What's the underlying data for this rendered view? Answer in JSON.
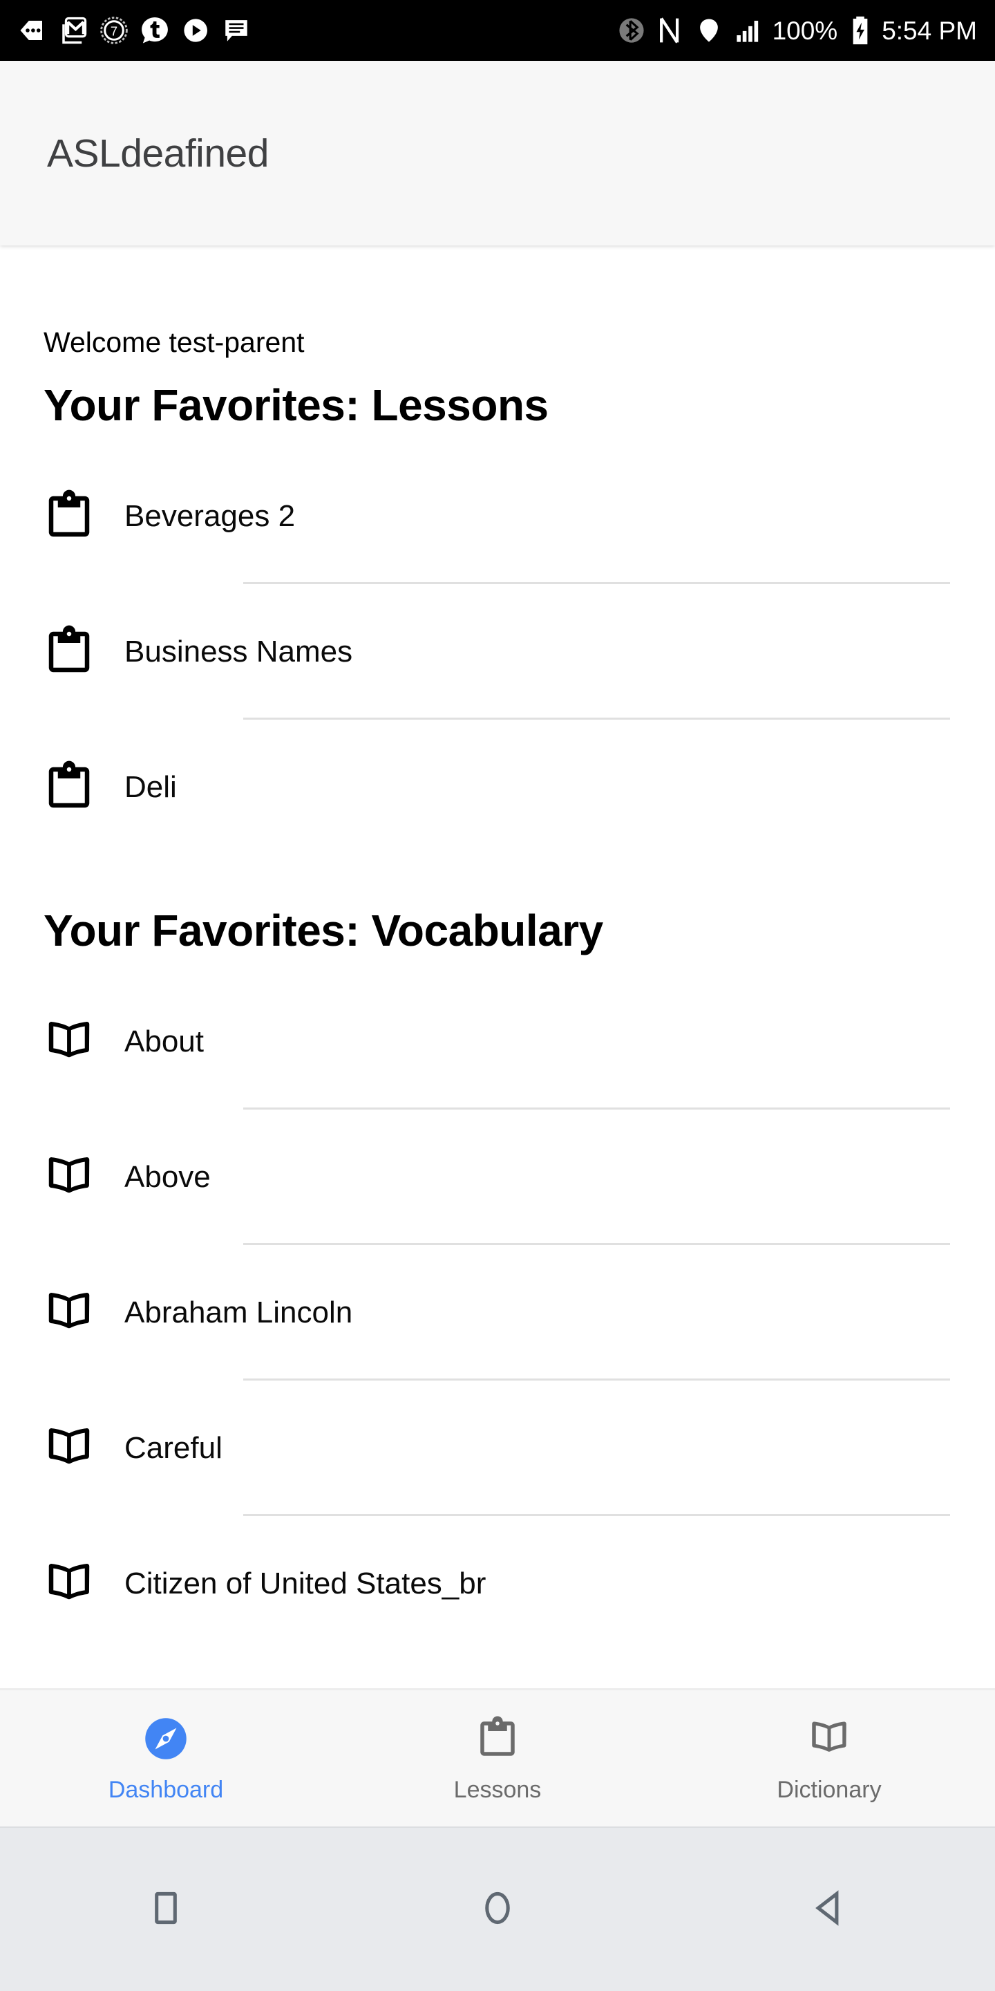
{
  "status_bar": {
    "left_icons": [
      "more-arrow-icon",
      "gmail-icon",
      "seven-circle-icon",
      "tumblr-icon",
      "play-circle-icon",
      "message-icon"
    ],
    "bluetooth_icon": "bluetooth-icon",
    "nfc_icon": "nfc-icon",
    "wifi_icon": "wifi-icon",
    "signal_icon": "cellular-signal-icon",
    "battery_percent": "100%",
    "battery_icon": "battery-charging-icon",
    "time": "5:54 PM"
  },
  "app_bar": {
    "title": "ASLdeafined"
  },
  "main": {
    "welcome": "Welcome test-parent",
    "lessons_section_title": "Your Favorites: Lessons",
    "lessons": [
      {
        "label": "Beverages 2",
        "icon": "clipboard-icon"
      },
      {
        "label": "Business Names",
        "icon": "clipboard-icon"
      },
      {
        "label": "Deli",
        "icon": "clipboard-icon"
      }
    ],
    "vocabulary_section_title": "Your Favorites: Vocabulary",
    "vocabulary": [
      {
        "label": "About",
        "icon": "book-icon"
      },
      {
        "label": "Above",
        "icon": "book-icon"
      },
      {
        "label": "Abraham Lincoln",
        "icon": "book-icon"
      },
      {
        "label": "Careful",
        "icon": "book-icon"
      },
      {
        "label": "Citizen of United States_br",
        "icon": "book-icon"
      }
    ]
  },
  "bottom_nav": {
    "active_color": "#4285F4",
    "inactive_color": "#6b6b6b",
    "items": [
      {
        "label": "Dashboard",
        "icon": "compass-explore-icon",
        "active": true
      },
      {
        "label": "Lessons",
        "icon": "clipboard-icon",
        "active": false
      },
      {
        "label": "Dictionary",
        "icon": "book-icon",
        "active": false
      }
    ]
  },
  "android_nav": {
    "items": [
      {
        "icon": "recents-square-icon"
      },
      {
        "icon": "home-circle-icon"
      },
      {
        "icon": "back-triangle-icon"
      }
    ]
  }
}
